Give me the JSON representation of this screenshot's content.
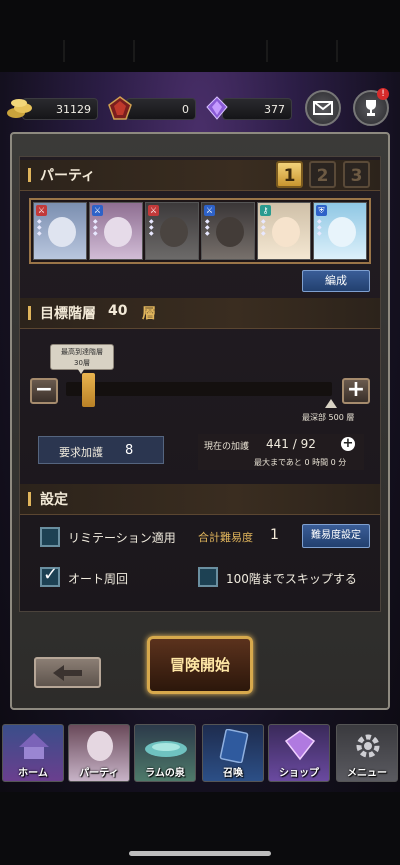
{
  "currency": {
    "gold": "31129",
    "gem": "0",
    "crystal": "377"
  },
  "header": {
    "notification_badge": "!"
  },
  "party": {
    "title": "パーティ",
    "tabs": [
      "1",
      "2",
      "3"
    ],
    "active_tab": "1",
    "edit_button": "編成",
    "members": [
      {
        "element": "red",
        "icon": "sword-icon",
        "face": "#cfd5e6"
      },
      {
        "element": "blue",
        "icon": "sword-icon",
        "face": "#d7cde0"
      },
      {
        "element": "red",
        "icon": "sword-icon",
        "face": "#3a3431"
      },
      {
        "element": "blue",
        "icon": "sword-icon",
        "face": "#2e2a2a"
      },
      {
        "element": "teal",
        "icon": "key-icon",
        "face": "#f0dcc1"
      },
      {
        "element": "blue",
        "icon": "shield-icon",
        "face": "#bfe2f2"
      }
    ]
  },
  "target_floor": {
    "title": "目標階層",
    "value": "40",
    "unit": "層",
    "tooltip_line1": "最高到達階層",
    "tooltip_line2": "30層",
    "deepest_label": "最深部 500 層",
    "slider_value_fraction": 0.08
  },
  "blessing": {
    "required_label": "要求加護",
    "required_value": "8",
    "current_label": "現在の加護",
    "current_value": "441 / 92",
    "time_to_max": "最大まであと 0 時間 0 分"
  },
  "settings": {
    "title": "設定",
    "limitation_label": "リミテーション適用",
    "limitation_checked": false,
    "total_difficulty_label": "合計難易度",
    "total_difficulty_value": "1",
    "difficulty_button": "難易度設定",
    "auto_loop_label": "オート周回",
    "auto_loop_checked": true,
    "skip_label": "100階までスキップする",
    "skip_checked": false
  },
  "actions": {
    "start_label": "冒険開始"
  },
  "nav": {
    "items": [
      "ホーム",
      "パーティ",
      "ラムの泉",
      "召喚",
      "ショップ",
      "メニュー"
    ]
  },
  "colors": {
    "accent_gold": "#e0b55c",
    "element_red": "#c23a3a",
    "element_blue": "#2e62c8",
    "element_teal": "#2a9b8f"
  }
}
